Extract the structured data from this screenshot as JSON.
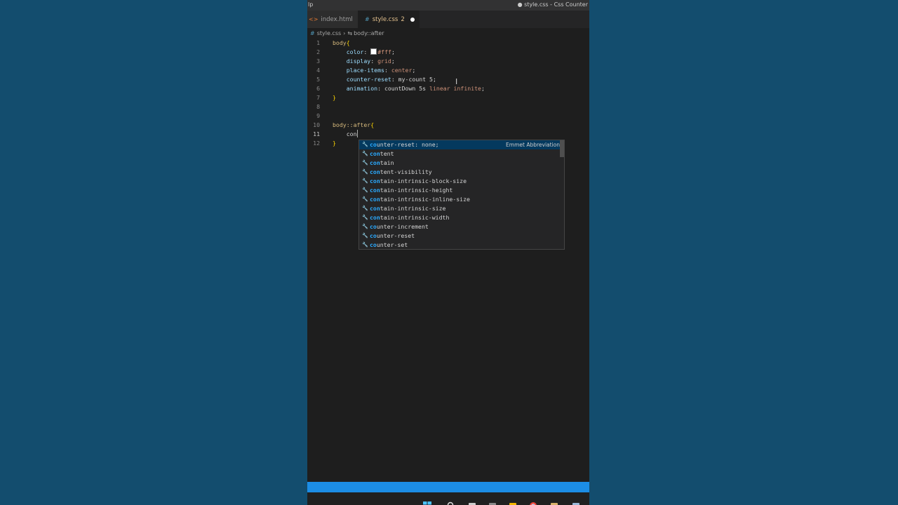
{
  "titlebar": {
    "app_fragment": "lp",
    "window_title": "● style.css - Css Counter"
  },
  "tabs": [
    {
      "label": "index.html",
      "icon": "html-file-icon",
      "active": false
    },
    {
      "label": "style.css",
      "icon": "css-file-icon",
      "badge": "2",
      "modified": true,
      "active": true
    }
  ],
  "breadcrumb": {
    "file": "style.css",
    "symbol": "body::after"
  },
  "code_lines": [
    {
      "n": "1",
      "tokens": [
        {
          "t": "body",
          "c": "sel"
        },
        {
          "t": "{",
          "c": "brace"
        }
      ]
    },
    {
      "n": "2",
      "tokens": [
        {
          "t": "    ",
          "c": "pun"
        },
        {
          "t": "color",
          "c": "prop"
        },
        {
          "t": ": ",
          "c": "pun"
        },
        {
          "t": "",
          "c": "swatch"
        },
        {
          "t": "#fff",
          "c": "val"
        },
        {
          "t": ";",
          "c": "pun"
        }
      ]
    },
    {
      "n": "3",
      "tokens": [
        {
          "t": "    ",
          "c": "pun"
        },
        {
          "t": "display",
          "c": "prop"
        },
        {
          "t": ": ",
          "c": "pun"
        },
        {
          "t": "grid",
          "c": "val"
        },
        {
          "t": ";",
          "c": "pun"
        }
      ]
    },
    {
      "n": "4",
      "tokens": [
        {
          "t": "    ",
          "c": "pun"
        },
        {
          "t": "place-items",
          "c": "prop"
        },
        {
          "t": ": ",
          "c": "pun"
        },
        {
          "t": "center",
          "c": "val"
        },
        {
          "t": ";",
          "c": "pun"
        }
      ]
    },
    {
      "n": "5",
      "tokens": [
        {
          "t": "    ",
          "c": "pun"
        },
        {
          "t": "counter-reset",
          "c": "prop"
        },
        {
          "t": ": ",
          "c": "pun"
        },
        {
          "t": "my-count 5",
          "c": "pun"
        },
        {
          "t": ";",
          "c": "pun"
        }
      ]
    },
    {
      "n": "6",
      "tokens": [
        {
          "t": "    ",
          "c": "pun"
        },
        {
          "t": "animation",
          "c": "prop"
        },
        {
          "t": ": ",
          "c": "pun"
        },
        {
          "t": "countDown 5s ",
          "c": "pun"
        },
        {
          "t": "linear infinite",
          "c": "val"
        },
        {
          "t": ";",
          "c": "pun"
        }
      ]
    },
    {
      "n": "7",
      "tokens": [
        {
          "t": "}",
          "c": "brace"
        }
      ]
    },
    {
      "n": "8",
      "tokens": []
    },
    {
      "n": "9",
      "tokens": []
    },
    {
      "n": "10",
      "tokens": [
        {
          "t": "body::after",
          "c": "sel"
        },
        {
          "t": "{",
          "c": "brace"
        }
      ]
    },
    {
      "n": "11",
      "current": true,
      "tokens": [
        {
          "t": "    ",
          "c": "pun"
        },
        {
          "t": "con",
          "c": "pun"
        },
        {
          "t": "",
          "c": "cursor"
        }
      ]
    },
    {
      "n": "12",
      "tokens": [
        {
          "t": "}",
          "c": "brace"
        }
      ]
    }
  ],
  "suggestions": [
    {
      "match": "co",
      "rest": "unter-reset: none;",
      "detail": "Emmet Abbreviation",
      "selected": true
    },
    {
      "match": "con",
      "rest": "tent"
    },
    {
      "match": "con",
      "rest": "tain"
    },
    {
      "match": "con",
      "rest": "tent-visibility"
    },
    {
      "match": "con",
      "rest": "tain-intrinsic-block-size"
    },
    {
      "match": "con",
      "rest": "tain-intrinsic-height"
    },
    {
      "match": "con",
      "rest": "tain-intrinsic-inline-size"
    },
    {
      "match": "con",
      "rest": "tain-intrinsic-size"
    },
    {
      "match": "con",
      "rest": "tain-intrinsic-width"
    },
    {
      "match": "co",
      "rest": "unter-increment"
    },
    {
      "match": "co",
      "rest": "unter-reset"
    },
    {
      "match": "co",
      "rest": "unter-set"
    }
  ],
  "colors": {
    "desktop": "#134d6e",
    "editor_bg": "#1e1e1e",
    "statusbar": "#1c8de5",
    "selector": "#d7ba7d",
    "property": "#9cdcfe",
    "value": "#ce9178"
  },
  "taskbar_icons": [
    "windows-start-icon",
    "search-icon",
    "task-view-icon",
    "widgets-icon",
    "file-explorer-icon",
    "chrome-icon",
    "app-icon",
    "store-icon"
  ]
}
